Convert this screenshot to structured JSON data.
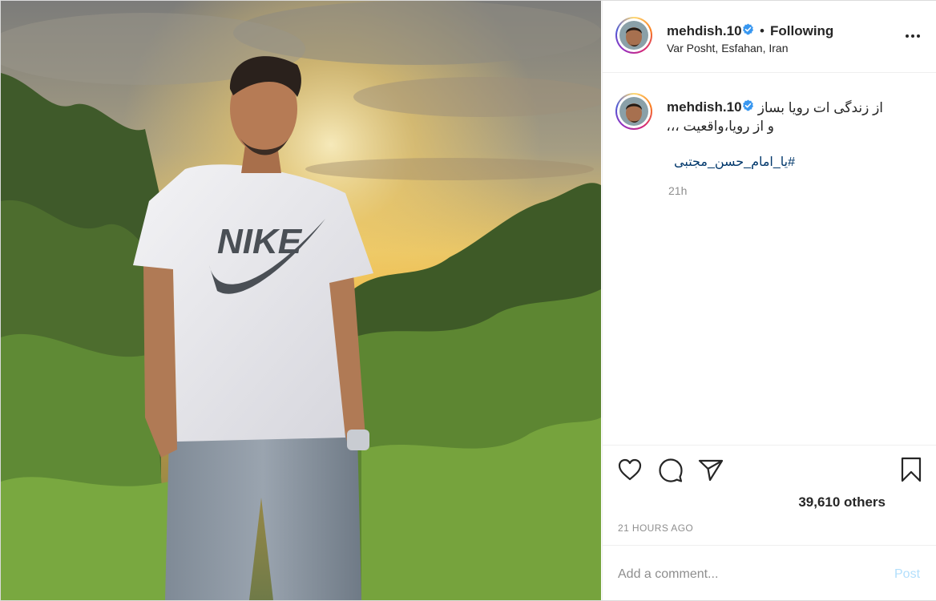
{
  "post": {
    "username": "mehdish.10",
    "follow_status": "Following",
    "separator": "•",
    "location": "Var Posht, Esfahan, Iran",
    "caption_line1": "از زندگی ات رویا بساز",
    "caption_line2": "و از رویا،واقعیت ،،،",
    "hashtag": "#یا_امام_حسن_مجتبی",
    "caption_time": "21h",
    "likes_text": "39,610 others",
    "posted_ago": "21 HOURS AGO",
    "photo_brand_text": "NIKE"
  },
  "comment": {
    "placeholder": "Add a comment...",
    "post_label": "Post"
  },
  "icons": {
    "like": "heart-icon",
    "comment": "comment-bubble-icon",
    "share": "paper-plane-icon",
    "save": "bookmark-icon",
    "verified": "verified-badge-icon",
    "more": "more-options-icon"
  },
  "colors": {
    "link": "#00376b",
    "verified": "#3897f0",
    "post_disabled": "#b2dffc",
    "muted": "#8e8e8e"
  }
}
